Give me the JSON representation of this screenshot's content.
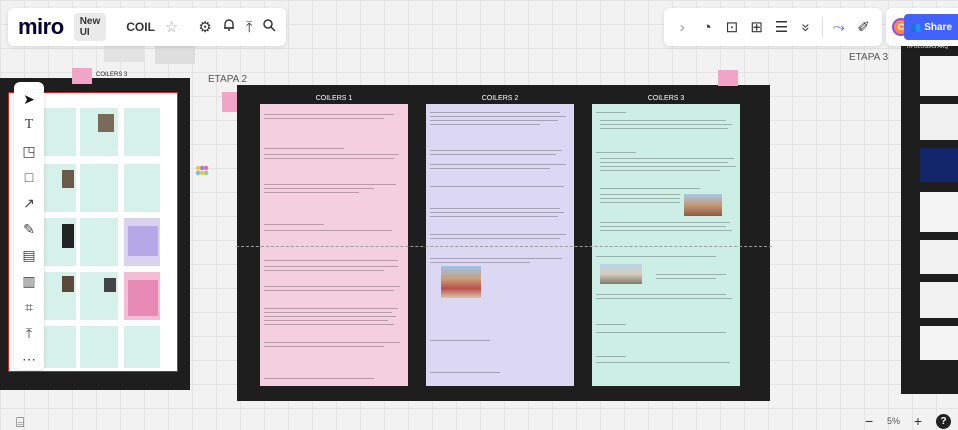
{
  "topbar": {
    "logo": "miro",
    "badge": "New UI",
    "board_name": "COIL",
    "icons": {
      "star": "☆",
      "settings": "⚙",
      "bell": "🔔",
      "upload": "⤒",
      "search": "⌕"
    }
  },
  "right_toolbar": {
    "icons": {
      "expand": "›",
      "timer": "◔",
      "present": "⊡",
      "comment": "⊞",
      "notes": "☰",
      "more": "»"
    }
  },
  "collab": {
    "reactions_icon": "⤳",
    "cursor_icon": "✐",
    "avatar_initial": "C",
    "share_label": "Share",
    "share_icon": "👥"
  },
  "left_toolbar": {
    "tools": [
      "➤",
      "T",
      "◳",
      "□",
      "↗",
      "✎",
      "▤",
      "▥",
      "⌗",
      "⤒",
      "⋯"
    ]
  },
  "canvas": {
    "label_etapa2": "ETAPA 2",
    "label_etapa3": "ETAPA 3",
    "label_tipologias": "TIPOLOGÍAS ARQ",
    "left_frame_tag": "COILERS 3",
    "main_frame_tag": "ETAPA 2",
    "columns": [
      "COILERS 1",
      "COILERS 2",
      "COILERS 3"
    ],
    "colors": {
      "pink": "#f4cfe0",
      "lavender": "#dcd8f3",
      "mint": "#cdeee4",
      "frame": "#1e1e1e"
    }
  },
  "bottom": {
    "frames_icon": "⌸",
    "zoom_out": "−",
    "zoom_value": "5%",
    "zoom_in": "+",
    "help": "?"
  }
}
